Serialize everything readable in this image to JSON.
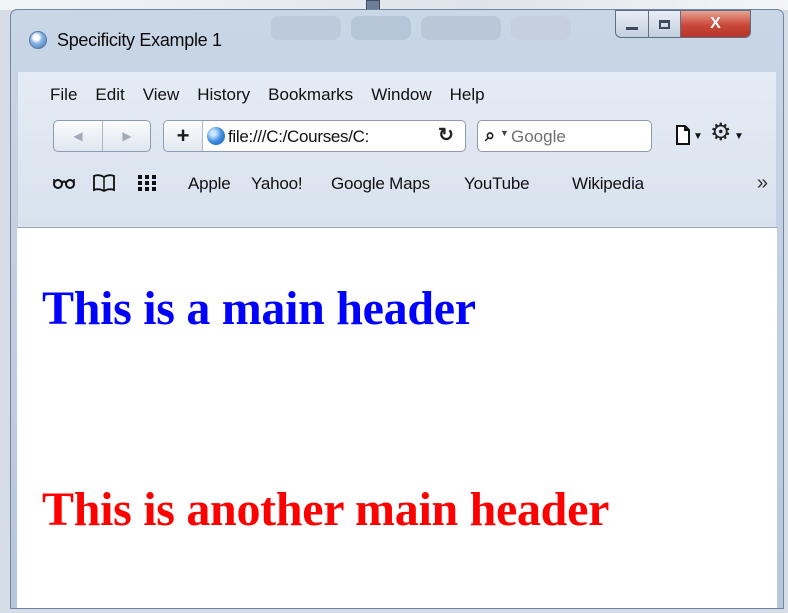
{
  "window": {
    "title": "Specificity Example 1",
    "minimize_icon": "minimize-icon",
    "maximize_icon": "maximize-icon",
    "close_label": "X"
  },
  "menu": [
    "File",
    "Edit",
    "View",
    "History",
    "Bookmarks",
    "Window",
    "Help"
  ],
  "navigation": {
    "back_glyph": "◀",
    "forward_glyph": "▶",
    "add_glyph": "+",
    "url": "file:///C:/Courses/C:",
    "reload_glyph": "↻",
    "search_placeholder": "Google"
  },
  "bookmarks": {
    "icons": [
      "reading-glasses-icon",
      "open-book-icon",
      "grid-icon"
    ],
    "links": [
      "Apple",
      "Yahoo!",
      "Google Maps",
      "YouTube",
      "Wikipedia"
    ],
    "overflow_glyph": "»"
  },
  "page": {
    "header_main": "This is a main header",
    "header_another": "This is another main header"
  },
  "colors": {
    "header_main": "#0000ff",
    "header_another": "#ff0000",
    "close_button": "#c9473a"
  }
}
